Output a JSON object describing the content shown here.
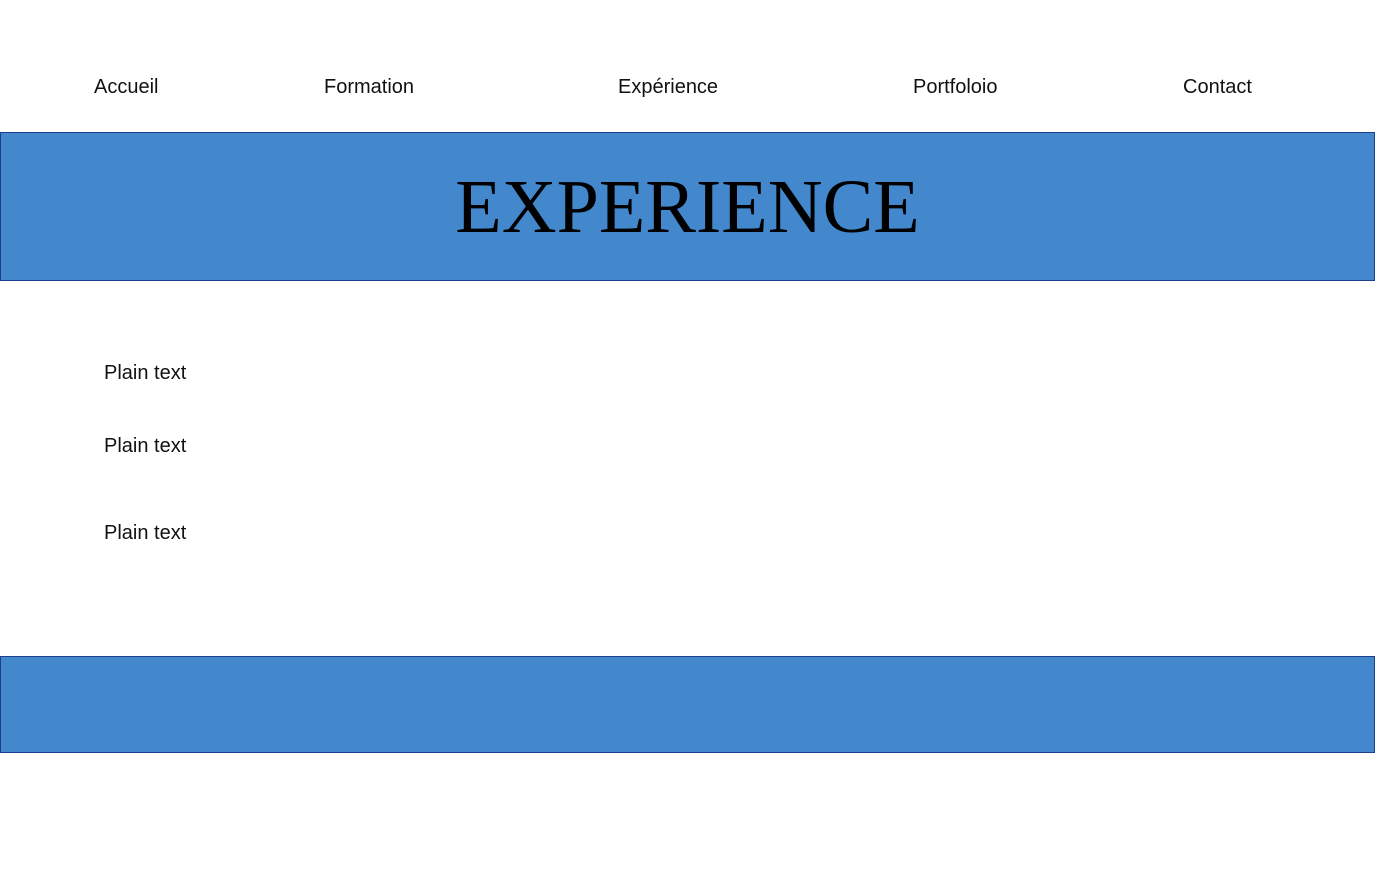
{
  "nav": {
    "items": [
      {
        "label": "Accueil"
      },
      {
        "label": "Formation"
      },
      {
        "label": "Expérience"
      },
      {
        "label": "Portfoloio"
      },
      {
        "label": "Contact"
      }
    ]
  },
  "hero": {
    "title": "EXPERIENCE"
  },
  "content": {
    "paragraphs": [
      {
        "text": "Plain text"
      },
      {
        "text": "Plain text"
      },
      {
        "text": "Plain text"
      }
    ]
  },
  "colors": {
    "banner": "#4388cd",
    "banner_border": "#1d3f8a"
  }
}
